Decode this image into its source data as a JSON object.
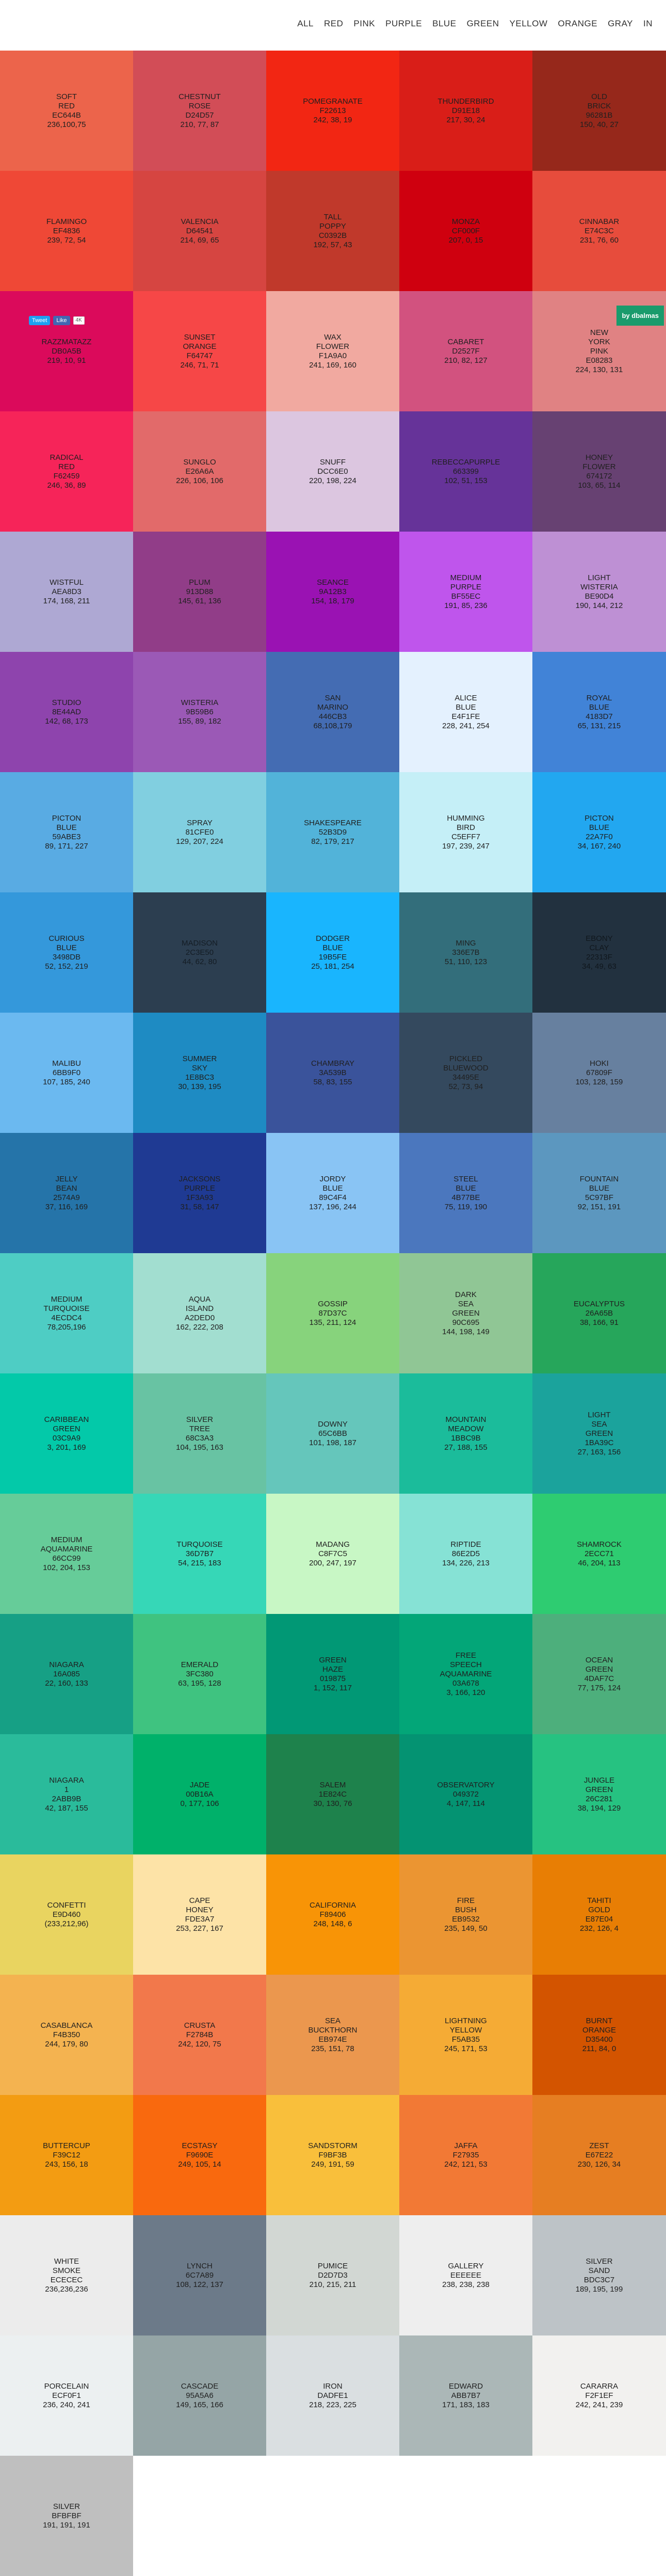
{
  "menu": [
    "ALL",
    "RED",
    "PINK",
    "PURPLE",
    "BLUE",
    "GREEN",
    "YELLOW",
    "ORANGE",
    "GRAY",
    "IN"
  ],
  "social": {
    "tweet": "Tweet",
    "like": "Like",
    "like_count": "4K"
  },
  "credit": "by dbalmas",
  "colors": [
    {
      "name": [
        "SOFT",
        "RED"
      ],
      "hex": "EC644B",
      "rgb": "236,100,75",
      "bg": "#EC644B"
    },
    {
      "name": [
        "CHESTNUT",
        "ROSE"
      ],
      "hex": "D24D57",
      "rgb": "210, 77, 87",
      "bg": "#D24D57"
    },
    {
      "name": [
        "POMEGRANATE"
      ],
      "hex": "F22613",
      "rgb": "242, 38, 19",
      "bg": "#F22613"
    },
    {
      "name": [
        "THUNDERBIRD"
      ],
      "hex": "D91E18",
      "rgb": "217, 30, 24",
      "bg": "#D91E18"
    },
    {
      "name": [
        "OLD",
        "BRICK"
      ],
      "hex": "96281B",
      "rgb": "150, 40, 27",
      "bg": "#96281B"
    },
    {
      "name": [
        "FLAMINGO"
      ],
      "hex": "EF4836",
      "rgb": "239, 72, 54",
      "bg": "#EF4836"
    },
    {
      "name": [
        "VALENCIA"
      ],
      "hex": "D64541",
      "rgb": "214, 69, 65",
      "bg": "#D64541"
    },
    {
      "name": [
        "TALL",
        "POPPY"
      ],
      "hex": "C0392B",
      "rgb": "192, 57, 43",
      "bg": "#C0392B"
    },
    {
      "name": [
        "MONZA"
      ],
      "hex": "CF000F",
      "rgb": "207, 0, 15",
      "bg": "#CF000F"
    },
    {
      "name": [
        "CINNABAR"
      ],
      "hex": "E74C3C",
      "rgb": "231, 76, 60",
      "bg": "#E74C3C"
    },
    {
      "name": [
        "RAZZMATAZZ"
      ],
      "hex": "DB0A5B",
      "rgb": "219, 10, 91",
      "bg": "#DB0A5B"
    },
    {
      "name": [
        "SUNSET",
        "ORANGE"
      ],
      "hex": "F64747",
      "rgb": "246, 71, 71",
      "bg": "#F64747"
    },
    {
      "name": [
        "WAX",
        "FLOWER"
      ],
      "hex": "F1A9A0",
      "rgb": "241, 169, 160",
      "bg": "#F1A9A0"
    },
    {
      "name": [
        "CABARET"
      ],
      "hex": "D2527F",
      "rgb": "210, 82, 127",
      "bg": "#D2527F"
    },
    {
      "name": [
        "NEW",
        "YORK",
        "PINK"
      ],
      "hex": "E08283",
      "rgb": "224, 130, 131",
      "bg": "#E08283"
    },
    {
      "name": [
        "RADICAL",
        "RED"
      ],
      "hex": "F62459",
      "rgb": "246, 36, 89",
      "bg": "#F62459"
    },
    {
      "name": [
        "SUNGLO"
      ],
      "hex": "E26A6A",
      "rgb": "226, 106, 106",
      "bg": "#E26A6A"
    },
    {
      "name": [
        "SNUFF"
      ],
      "hex": "DCC6E0",
      "rgb": "220, 198, 224",
      "bg": "#DCC6E0"
    },
    {
      "name": [
        "REBECCAPURPLE"
      ],
      "hex": "663399",
      "rgb": "102, 51, 153",
      "bg": "#663399"
    },
    {
      "name": [
        "HONEY",
        "FLOWER"
      ],
      "hex": "674172",
      "rgb": "103, 65, 114",
      "bg": "#674172"
    },
    {
      "name": [
        "WISTFUL"
      ],
      "hex": "AEA8D3",
      "rgb": "174, 168, 211",
      "bg": "#AEA8D3"
    },
    {
      "name": [
        "PLUM"
      ],
      "hex": "913D88",
      "rgb": "145, 61, 136",
      "bg": "#913D88"
    },
    {
      "name": [
        "SEANCE"
      ],
      "hex": "9A12B3",
      "rgb": "154, 18, 179",
      "bg": "#9A12B3"
    },
    {
      "name": [
        "MEDIUM",
        "PURPLE"
      ],
      "hex": "BF55EC",
      "rgb": "191, 85, 236",
      "bg": "#BF55EC"
    },
    {
      "name": [
        "LIGHT",
        "WISTERIA"
      ],
      "hex": "BE90D4",
      "rgb": "190, 144, 212",
      "bg": "#BE90D4"
    },
    {
      "name": [
        "STUDIO"
      ],
      "hex": "8E44AD",
      "rgb": "142, 68, 173",
      "bg": "#8E44AD"
    },
    {
      "name": [
        "WISTERIA"
      ],
      "hex": "9B59B6",
      "rgb": "155, 89, 182",
      "bg": "#9B59B6"
    },
    {
      "name": [
        "SAN",
        "MARINO"
      ],
      "hex": "446CB3",
      "rgb": "68,108,179",
      "bg": "#446CB3"
    },
    {
      "name": [
        "ALICE",
        "BLUE"
      ],
      "hex": "E4F1FE",
      "rgb": "228, 241, 254",
      "bg": "#E4F1FE"
    },
    {
      "name": [
        "ROYAL",
        "BLUE"
      ],
      "hex": "4183D7",
      "rgb": "65, 131, 215",
      "bg": "#4183D7"
    },
    {
      "name": [
        "PICTON",
        "BLUE"
      ],
      "hex": "59ABE3",
      "rgb": "89, 171, 227",
      "bg": "#59ABE3"
    },
    {
      "name": [
        "SPRAY"
      ],
      "hex": "81CFE0",
      "rgb": "129, 207, 224",
      "bg": "#81CFE0"
    },
    {
      "name": [
        "SHAKESPEARE"
      ],
      "hex": "52B3D9",
      "rgb": "82, 179, 217",
      "bg": "#52B3D9"
    },
    {
      "name": [
        "HUMMING",
        "BIRD"
      ],
      "hex": "C5EFF7",
      "rgb": "197, 239, 247",
      "bg": "#C5EFF7"
    },
    {
      "name": [
        "PICTON",
        "BLUE"
      ],
      "hex": "22A7F0",
      "rgb": "34, 167, 240",
      "bg": "#22A7F0"
    },
    {
      "name": [
        "CURIOUS",
        "BLUE"
      ],
      "hex": "3498DB",
      "rgb": "52, 152, 219",
      "bg": "#3498DB"
    },
    {
      "name": [
        "MADISON"
      ],
      "hex": "2C3E50",
      "rgb": "44, 62, 80",
      "bg": "#2C3E50"
    },
    {
      "name": [
        "DODGER",
        "BLUE"
      ],
      "hex": "19B5FE",
      "rgb": "25, 181, 254",
      "bg": "#19B5FE"
    },
    {
      "name": [
        "MING"
      ],
      "hex": "336E7B",
      "rgb": "51, 110, 123",
      "bg": "#336E7B"
    },
    {
      "name": [
        "EBONY",
        "CLAY"
      ],
      "hex": "22313F",
      "rgb": "34, 49, 63",
      "bg": "#22313F"
    },
    {
      "name": [
        "MALIBU"
      ],
      "hex": "6BB9F0",
      "rgb": "107, 185, 240",
      "bg": "#6BB9F0"
    },
    {
      "name": [
        "SUMMER",
        "SKY"
      ],
      "hex": "1E8BC3",
      "rgb": "30, 139, 195",
      "bg": "#1E8BC3"
    },
    {
      "name": [
        "CHAMBRAY"
      ],
      "hex": "3A539B",
      "rgb": "58, 83, 155",
      "bg": "#3A539B"
    },
    {
      "name": [
        "PICKLED",
        "BLUEWOOD"
      ],
      "hex": "34495E",
      "rgb": "52, 73, 94",
      "bg": "#34495E"
    },
    {
      "name": [
        "HOKI"
      ],
      "hex": "67809F",
      "rgb": "103, 128, 159",
      "bg": "#67809F"
    },
    {
      "name": [
        "JELLY",
        "BEAN"
      ],
      "hex": "2574A9",
      "rgb": "37, 116, 169",
      "bg": "#2574A9"
    },
    {
      "name": [
        "JACKSONS",
        "PURPLE"
      ],
      "hex": "1F3A93",
      "rgb": "31, 58, 147",
      "bg": "#1F3A93"
    },
    {
      "name": [
        "JORDY",
        "BLUE"
      ],
      "hex": "89C4F4",
      "rgb": "137, 196, 244",
      "bg": "#89C4F4"
    },
    {
      "name": [
        "STEEL",
        "BLUE"
      ],
      "hex": "4B77BE",
      "rgb": "75, 119, 190",
      "bg": "#4B77BE"
    },
    {
      "name": [
        "FOUNTAIN",
        "BLUE"
      ],
      "hex": "5C97BF",
      "rgb": "92, 151, 191",
      "bg": "#5C97BF"
    },
    {
      "name": [
        "MEDIUM",
        "TURQUOISE"
      ],
      "hex": "4ECDC4",
      "rgb": "78,205,196",
      "bg": "#4ECDC4"
    },
    {
      "name": [
        "AQUA",
        "ISLAND"
      ],
      "hex": "A2DED0",
      "rgb": "162, 222, 208",
      "bg": "#A2DED0"
    },
    {
      "name": [
        "GOSSIP"
      ],
      "hex": "87D37C",
      "rgb": "135, 211, 124",
      "bg": "#87D37C"
    },
    {
      "name": [
        "DARK",
        "SEA",
        "GREEN"
      ],
      "hex": "90C695",
      "rgb": "144, 198, 149",
      "bg": "#90C695"
    },
    {
      "name": [
        "EUCALYPTUS"
      ],
      "hex": "26A65B",
      "rgb": "38, 166, 91",
      "bg": "#26A65B"
    },
    {
      "name": [
        "CARIBBEAN",
        "GREEN"
      ],
      "hex": "03C9A9",
      "rgb": "3, 201, 169",
      "bg": "#03C9A9"
    },
    {
      "name": [
        "SILVER",
        "TREE"
      ],
      "hex": "68C3A3",
      "rgb": "104, 195, 163",
      "bg": "#68C3A3"
    },
    {
      "name": [
        "DOWNY"
      ],
      "hex": "65C6BB",
      "rgb": "101, 198, 187",
      "bg": "#65C6BB"
    },
    {
      "name": [
        "MOUNTAIN",
        "MEADOW"
      ],
      "hex": "1BBC9B",
      "rgb": "27, 188, 155",
      "bg": "#1BBC9B"
    },
    {
      "name": [
        "LIGHT",
        "SEA",
        "GREEN"
      ],
      "hex": "1BA39C",
      "rgb": "27, 163, 156",
      "bg": "#1BA39C"
    },
    {
      "name": [
        "MEDIUM",
        "AQUAMARINE"
      ],
      "hex": "66CC99",
      "rgb": "102, 204, 153",
      "bg": "#66CC99"
    },
    {
      "name": [
        "TURQUOISE"
      ],
      "hex": "36D7B7",
      "rgb": "54, 215, 183",
      "bg": "#36D7B7"
    },
    {
      "name": [
        "MADANG"
      ],
      "hex": "C8F7C5",
      "rgb": "200, 247, 197",
      "bg": "#C8F7C5"
    },
    {
      "name": [
        "RIPTIDE"
      ],
      "hex": "86E2D5",
      "rgb": "134, 226, 213",
      "bg": "#86E2D5"
    },
    {
      "name": [
        "SHAMROCK"
      ],
      "hex": "2ECC71",
      "rgb": "46, 204, 113",
      "bg": "#2ECC71"
    },
    {
      "name": [
        "NIAGARA"
      ],
      "hex": "16A085",
      "rgb": "22, 160, 133",
      "bg": "#16A085"
    },
    {
      "name": [
        "EMERALD"
      ],
      "hex": "3FC380",
      "rgb": "63, 195, 128",
      "bg": "#3FC380"
    },
    {
      "name": [
        "GREEN",
        "HAZE"
      ],
      "hex": "019875",
      "rgb": "1, 152, 117",
      "bg": "#019875"
    },
    {
      "name": [
        "FREE",
        "SPEECH",
        "AQUAMARINE"
      ],
      "hex": "03A678",
      "rgb": "3, 166, 120",
      "bg": "#03A678"
    },
    {
      "name": [
        "OCEAN",
        "GREEN"
      ],
      "hex": "4DAF7C",
      "rgb": "77, 175, 124",
      "bg": "#4DAF7C"
    },
    {
      "name": [
        "NIAGARA",
        "1"
      ],
      "hex": "2ABB9B",
      "rgb": "42, 187, 155",
      "bg": "#2ABB9B"
    },
    {
      "name": [
        "JADE"
      ],
      "hex": "00B16A",
      "rgb": "0, 177, 106",
      "bg": "#00B16A"
    },
    {
      "name": [
        "SALEM"
      ],
      "hex": "1E824C",
      "rgb": "30, 130, 76",
      "bg": "#1E824C"
    },
    {
      "name": [
        "OBSERVATORY"
      ],
      "hex": "049372",
      "rgb": "4, 147, 114",
      "bg": "#049372"
    },
    {
      "name": [
        "JUNGLE",
        "GREEN"
      ],
      "hex": "26C281",
      "rgb": "38, 194, 129",
      "bg": "#26C281"
    },
    {
      "name": [
        "CONFETTI"
      ],
      "hex": "E9D460",
      "rgb": "(233,212,96)",
      "bg": "#E9D460"
    },
    {
      "name": [
        "CAPE",
        "HONEY"
      ],
      "hex": "FDE3A7",
      "rgb": "253, 227, 167",
      "bg": "#FDE3A7"
    },
    {
      "name": [
        "CALIFORNIA"
      ],
      "hex": "F89406",
      "rgb": "248, 148, 6",
      "bg": "#F89406"
    },
    {
      "name": [
        "FIRE",
        "BUSH"
      ],
      "hex": "EB9532",
      "rgb": "235, 149, 50",
      "bg": "#EB9532"
    },
    {
      "name": [
        "TAHITI",
        "GOLD"
      ],
      "hex": "E87E04",
      "rgb": "232, 126, 4",
      "bg": "#E87E04"
    },
    {
      "name": [
        "CASABLANCA"
      ],
      "hex": "F4B350",
      "rgb": "244, 179, 80",
      "bg": "#F4B350"
    },
    {
      "name": [
        "CRUSTA"
      ],
      "hex": "F2784B",
      "rgb": "242, 120, 75",
      "bg": "#F2784B"
    },
    {
      "name": [
        "SEA",
        "BUCKTHORN"
      ],
      "hex": "EB974E",
      "rgb": "235, 151, 78",
      "bg": "#EB974E"
    },
    {
      "name": [
        "LIGHTNING",
        "YELLOW"
      ],
      "hex": "F5AB35",
      "rgb": "245, 171, 53",
      "bg": "#F5AB35"
    },
    {
      "name": [
        "BURNT",
        "ORANGE"
      ],
      "hex": "D35400",
      "rgb": "211, 84, 0",
      "bg": "#D35400"
    },
    {
      "name": [
        "BUTTERCUP"
      ],
      "hex": "F39C12",
      "rgb": "243, 156, 18",
      "bg": "#F39C12"
    },
    {
      "name": [
        "ECSTASY"
      ],
      "hex": "F9690E",
      "rgb": "249, 105, 14",
      "bg": "#F9690E"
    },
    {
      "name": [
        "SANDSTORM"
      ],
      "hex": "F9BF3B",
      "rgb": "249, 191, 59",
      "bg": "#F9BF3B"
    },
    {
      "name": [
        "JAFFA"
      ],
      "hex": "F27935",
      "rgb": "242, 121, 53",
      "bg": "#F27935"
    },
    {
      "name": [
        "ZEST"
      ],
      "hex": "E67E22",
      "rgb": "230, 126, 34",
      "bg": "#E67E22"
    },
    {
      "name": [
        "WHITE",
        "SMOKE"
      ],
      "hex": "ECECEC",
      "rgb": "236,236,236",
      "bg": "#ECECEC"
    },
    {
      "name": [
        "LYNCH"
      ],
      "hex": "6C7A89",
      "rgb": "108, 122, 137",
      "bg": "#6C7A89"
    },
    {
      "name": [
        "PUMICE"
      ],
      "hex": "D2D7D3",
      "rgb": "210, 215, 211",
      "bg": "#D2D7D3"
    },
    {
      "name": [
        "GALLERY"
      ],
      "hex": "EEEEEE",
      "rgb": "238, 238, 238",
      "bg": "#EEEEEE"
    },
    {
      "name": [
        "SILVER",
        "SAND"
      ],
      "hex": "BDC3C7",
      "rgb": "189, 195, 199",
      "bg": "#BDC3C7"
    },
    {
      "name": [
        "PORCELAIN"
      ],
      "hex": "ECF0F1",
      "rgb": "236, 240, 241",
      "bg": "#ECF0F1"
    },
    {
      "name": [
        "CASCADE"
      ],
      "hex": "95A5A6",
      "rgb": "149, 165, 166",
      "bg": "#95A5A6"
    },
    {
      "name": [
        "IRON"
      ],
      "hex": "DADFE1",
      "rgb": "218, 223, 225",
      "bg": "#DADFE1"
    },
    {
      "name": [
        "EDWARD"
      ],
      "hex": "ABB7B7",
      "rgb": "171, 183, 183",
      "bg": "#ABB7B7"
    },
    {
      "name": [
        "CARARRA"
      ],
      "hex": "F2F1EF",
      "rgb": "242, 241, 239",
      "bg": "#F2F1EF"
    },
    {
      "name": [
        "SILVER"
      ],
      "hex": "BFBFBF",
      "rgb": "191, 191, 191",
      "bg": "#BFBFBF"
    }
  ]
}
